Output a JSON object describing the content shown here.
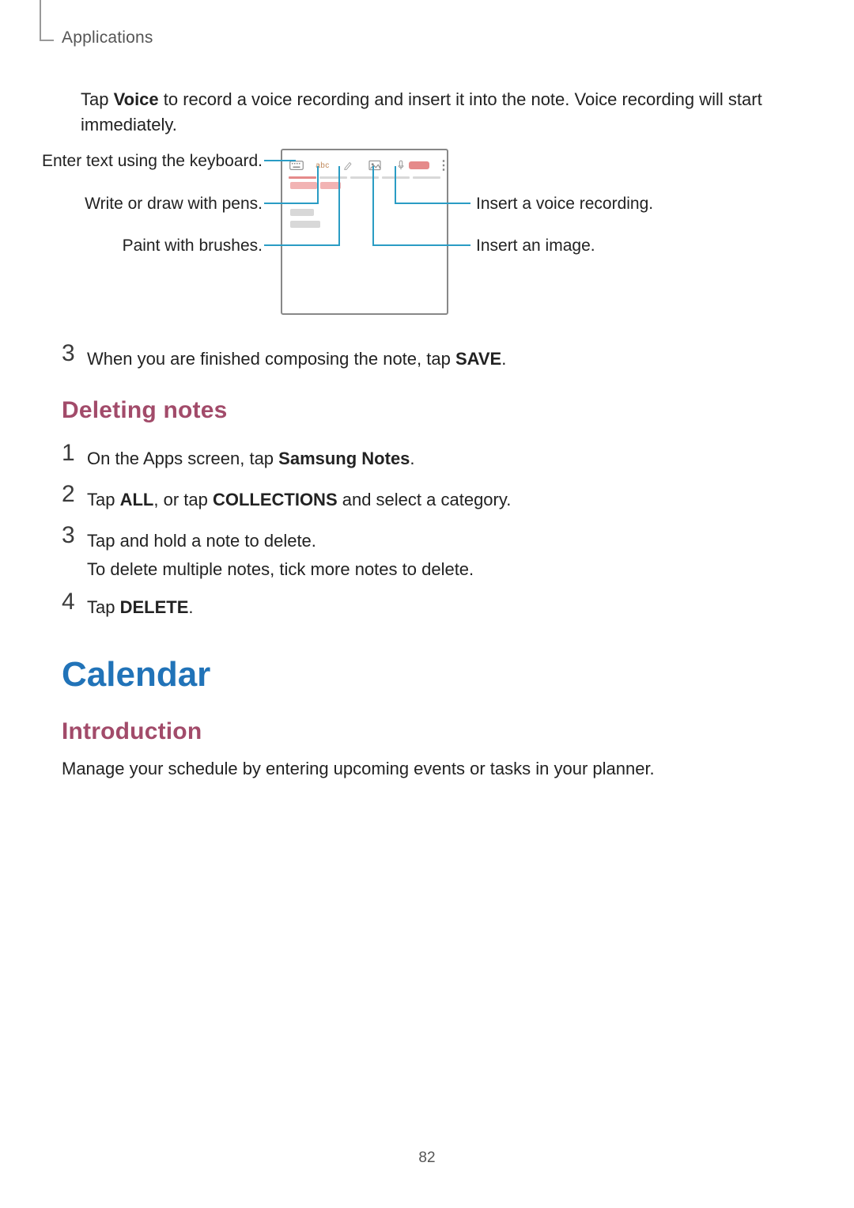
{
  "header": {
    "chapter": "Applications"
  },
  "intro": {
    "full": "Tap Voice to record a voice recording and insert it into the note. Voice recording will start immediately.",
    "p1a": "Tap ",
    "p1b": "Voice",
    "p1c": " to record a voice recording and insert it into the note. Voice recording will start immediately."
  },
  "diagram": {
    "left": {
      "l1": "Enter text using the keyboard.",
      "l2": "Write or draw with pens.",
      "l3": "Paint with brushes."
    },
    "right": {
      "r1": "Insert a voice recording.",
      "r2": "Insert an image."
    },
    "icons": {
      "keyboard": "keyboard-icon",
      "abc": "abc",
      "pen": "pen-icon",
      "image": "image-icon",
      "mic": "mic-icon",
      "save": "save-pill",
      "more": "more-icon"
    }
  },
  "steps_top": {
    "s3num": "3",
    "s3a": "When you are finished composing the note, tap ",
    "s3b": "SAVE",
    "s3c": "."
  },
  "deleting": {
    "heading": "Deleting notes",
    "s1num": "1",
    "s1a": "On the Apps screen, tap ",
    "s1b": "Samsung Notes",
    "s1c": ".",
    "s2num": "2",
    "s2a": "Tap ",
    "s2b": "ALL",
    "s2c": ", or tap ",
    "s2d": "COLLECTIONS",
    "s2e": " and select a category.",
    "s3num": "3",
    "s3line1": "Tap and hold a note to delete.",
    "s3line2": "To delete multiple notes, tick more notes to delete.",
    "s4num": "4",
    "s4a": "Tap ",
    "s4b": "DELETE",
    "s4c": "."
  },
  "calendar": {
    "title": "Calendar",
    "sub": "Introduction",
    "intro": "Manage your schedule by entering upcoming events or tasks in your planner."
  },
  "page_number": "82"
}
